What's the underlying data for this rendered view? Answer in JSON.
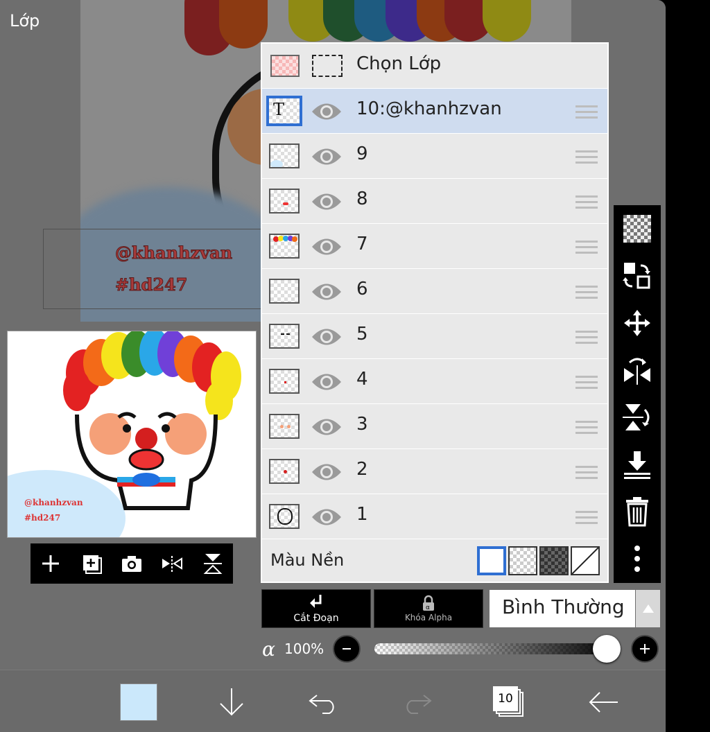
{
  "header": {
    "title": "Lớp"
  },
  "canvas": {
    "watermark_line1": "@khanhzvan",
    "watermark_line2": "#hd247"
  },
  "preview": {
    "watermark_line1": "@khanhzvan",
    "watermark_line2": "#hd247"
  },
  "preview_toolbar": {
    "icons": [
      "plus-icon",
      "add-layer-icon",
      "camera-icon",
      "flip-horizontal-icon",
      "flip-vertical-icon"
    ]
  },
  "layers": {
    "select_row_label": "Chọn Lớp",
    "items": [
      {
        "name": "10:@khanhzvan",
        "selected": true,
        "thumb": "text"
      },
      {
        "name": "9",
        "selected": false,
        "thumb": "blue"
      },
      {
        "name": "8",
        "selected": false,
        "thumb": "mouth"
      },
      {
        "name": "7",
        "selected": false,
        "thumb": "hair"
      },
      {
        "name": "6",
        "selected": false,
        "thumb": "empty"
      },
      {
        "name": "5",
        "selected": false,
        "thumb": "brows"
      },
      {
        "name": "4",
        "selected": false,
        "thumb": "dot"
      },
      {
        "name": "3",
        "selected": false,
        "thumb": "cheeks"
      },
      {
        "name": "2",
        "selected": false,
        "thumb": "nose"
      },
      {
        "name": "1",
        "selected": false,
        "thumb": "outline"
      }
    ],
    "background_label": "Màu Nền"
  },
  "side_toolbar": {
    "icons": [
      "transparency-icon",
      "swap-layer-icon",
      "move-icon",
      "flip-horizontal-icon",
      "flip-vertical-icon",
      "merge-down-icon",
      "trash-icon",
      "more-vertical-icon"
    ]
  },
  "controls": {
    "clipping_label": "Cắt Đoạn",
    "alpha_lock_label": "Khóa Alpha",
    "blend_mode": "Bình Thường",
    "alpha_symbol": "α",
    "opacity_label": "100%",
    "opacity": 1.0
  },
  "bottom_bar": {
    "color_swatch": "#cbe8fb",
    "layer_count": "10",
    "icons": [
      "color-swatch",
      "download-arrow-icon",
      "undo-icon",
      "redo-icon",
      "layers-icon",
      "back-arrow-icon"
    ]
  },
  "colors": {
    "selected_row": "#cfdcef",
    "accent_blue": "#2f6fd2"
  }
}
